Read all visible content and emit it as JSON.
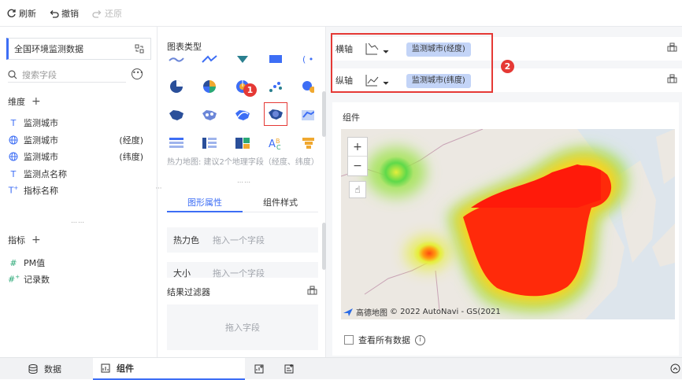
{
  "toolbar": {
    "refresh": "刷新",
    "undo": "撤销",
    "redo": "还原"
  },
  "data_panel": {
    "dataset": "全国环境监测数据",
    "search_placeholder": "搜索字段",
    "dimensions_label": "维度",
    "dimensions": [
      {
        "icon": "text",
        "label": "监测城市",
        "suffix": ""
      },
      {
        "icon": "globe",
        "label": "监测城市",
        "suffix": "(经度)"
      },
      {
        "icon": "globe",
        "label": "监测城市",
        "suffix": "(纬度)"
      },
      {
        "icon": "text",
        "label": "监测点名称",
        "suffix": ""
      },
      {
        "icon": "text-star",
        "label": "指标名称",
        "suffix": ""
      }
    ],
    "measures_label": "指标",
    "measures": [
      {
        "icon": "hash",
        "label": "PM值"
      },
      {
        "icon": "hash-star",
        "label": "记录数"
      }
    ]
  },
  "chart_panel": {
    "title": "图表类型",
    "hint": "热力地图: 建议2个地理字段（经度、纬度）",
    "tabs": [
      "图形属性",
      "组件样式"
    ],
    "props": [
      {
        "label": "热力色",
        "placeholder": "拖入一个字段"
      },
      {
        "label": "大小",
        "placeholder": "拖入一个字段"
      }
    ],
    "filter_title": "结果过滤器",
    "filter_placeholder": "拖入字段",
    "badge1": "1"
  },
  "axes": {
    "x_label": "横轴",
    "x_field": "监测城市(经度)",
    "y_label": "纵轴",
    "y_field": "监测城市(纬度)",
    "badge2": "2"
  },
  "widget": {
    "title": "组件",
    "zoom_in": "+",
    "zoom_out": "−",
    "map_brand": "高德地图",
    "map_copyright": "© 2022 AutoNavi - GS(2021",
    "show_all": "查看所有数据",
    "info": "i"
  },
  "bottom_tabs": {
    "data": "数据",
    "widget": "组件"
  },
  "colors": {
    "accent": "#3d6ef5",
    "highlight": "#e53935",
    "pill": "#c3d4f7"
  }
}
